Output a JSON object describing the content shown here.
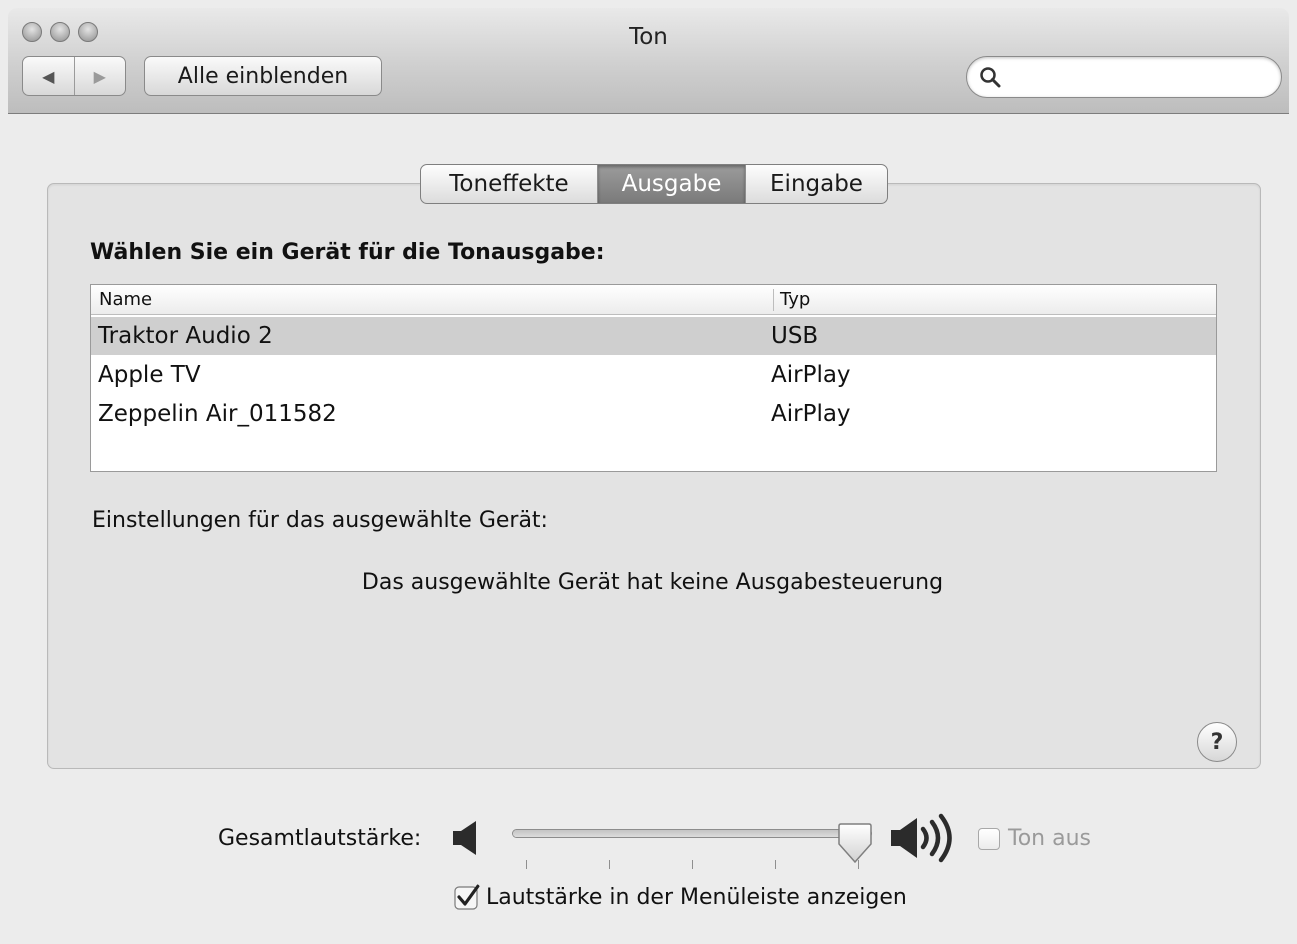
{
  "window": {
    "title": "Ton"
  },
  "toolbar": {
    "back_icon": "back-arrow-icon",
    "forward_icon": "forward-arrow-icon",
    "show_all_label": "Alle einblenden",
    "search_value": "",
    "search_icon": "magnifier-icon"
  },
  "tabs": [
    {
      "label": "Toneffekte",
      "selected": false
    },
    {
      "label": "Ausgabe",
      "selected": true
    },
    {
      "label": "Eingabe",
      "selected": false
    }
  ],
  "output": {
    "heading": "Wählen Sie ein Gerät für die Tonausgabe:",
    "columns": {
      "name": "Name",
      "type": "Typ"
    },
    "devices": [
      {
        "name": "Traktor Audio 2",
        "type": "USB",
        "selected": true
      },
      {
        "name": "Apple TV",
        "type": "AirPlay",
        "selected": false
      },
      {
        "name": "Zeppelin Air_011582",
        "type": "AirPlay",
        "selected": false
      }
    ],
    "settings_label": "Einstellungen für das ausgewählte Gerät:",
    "no_control_message": "Das ausgewählte Gerät hat keine Ausgabesteuerung"
  },
  "help": {
    "label": "?"
  },
  "volume": {
    "label": "Gesamtlautstärke:",
    "level": 0.98,
    "tick_count": 5,
    "mute_label": "Ton aus",
    "mute_checked": false,
    "menubar_label": "Lautstärke in der Menüleiste anzeigen",
    "menubar_checked": true
  },
  "colors": {
    "selected_tab": "#8a8a8a",
    "selected_row": "#cfcfcf",
    "window_bg": "#ececec"
  }
}
